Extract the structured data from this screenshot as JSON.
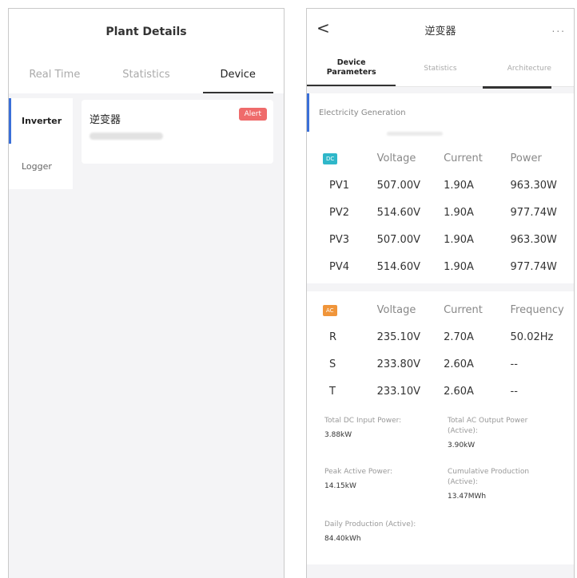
{
  "left": {
    "title": "Plant Details",
    "tabs": [
      "Real Time",
      "Statistics",
      "Device"
    ],
    "active_tab": "Device",
    "side_items": [
      "Inverter",
      "Logger"
    ],
    "device": {
      "name": "逆变器",
      "status": "Alert"
    }
  },
  "right": {
    "title": "逆变器",
    "back_icon": "chevron-left-icon",
    "more_icon": "more-dots-icon",
    "more_label": "...",
    "back_label": "<",
    "tabs": [
      "Device\nParameters",
      "Statistics",
      "Architecture"
    ],
    "section_title": "Electricity Generation",
    "dc": {
      "badge": "DC",
      "headers": [
        "Voltage",
        "Current",
        "Power"
      ],
      "rows": [
        [
          "PV1",
          "507.00V",
          "1.90A",
          "963.30W"
        ],
        [
          "PV2",
          "514.60V",
          "1.90A",
          "977.74W"
        ],
        [
          "PV3",
          "507.00V",
          "1.90A",
          "963.30W"
        ],
        [
          "PV4",
          "514.60V",
          "1.90A",
          "977.74W"
        ]
      ]
    },
    "ac": {
      "badge": "AC",
      "headers": [
        "Voltage",
        "Current",
        "Frequency"
      ],
      "rows": [
        [
          "R",
          "235.10V",
          "2.70A",
          "50.02Hz"
        ],
        [
          "S",
          "233.80V",
          "2.60A",
          "--"
        ],
        [
          "T",
          "233.10V",
          "2.60A",
          "--"
        ]
      ]
    },
    "summary": {
      "total_dc_label": "Total DC Input Power:",
      "total_dc_value": "3.88kW",
      "total_ac_label": "Total AC Output Power (Active):",
      "total_ac_value": "3.90kW",
      "peak_label": "Peak Active Power:",
      "peak_value": "14.15kW",
      "cumulative_label": "Cumulative Production (Active):",
      "cumulative_value": "13.47MWh",
      "daily_label": "Daily Production (Active):",
      "daily_value": "84.40kWh"
    }
  },
  "colors": {
    "accent_blue": "#3a6fd8",
    "alert_red": "#ef6b6b",
    "dc_badge": "#2fb7c9",
    "ac_badge": "#f0953a"
  }
}
